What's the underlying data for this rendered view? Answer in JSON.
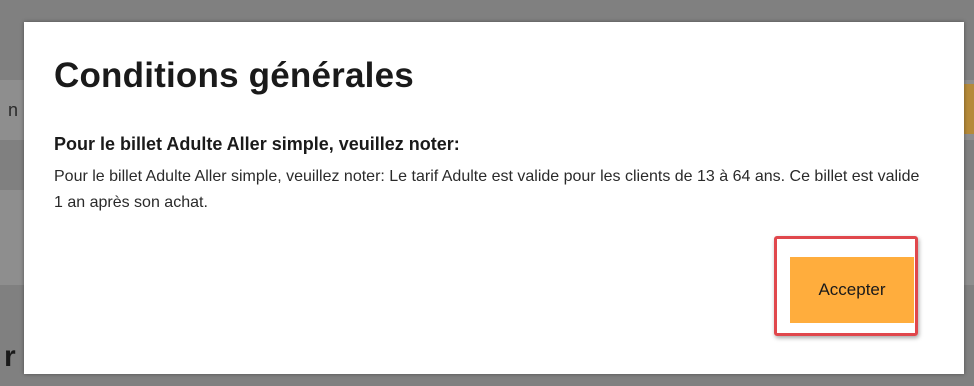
{
  "modal": {
    "title": "Conditions générales",
    "subtitle": "Pour le billet Adulte Aller simple, veuillez noter:",
    "body": "Pour le billet Adulte Aller simple, veuillez noter: Le tarif Adulte est valide pour les clients de 13 à 64 ans. Ce billet est valide 1 an après son achat.",
    "accept_label": "Accepter"
  },
  "background": {
    "left_fragment": "n",
    "left_fragment_2": "r"
  },
  "colors": {
    "accent": "#ffad3d",
    "highlight": "#e0474c",
    "overlay": "#808080"
  }
}
